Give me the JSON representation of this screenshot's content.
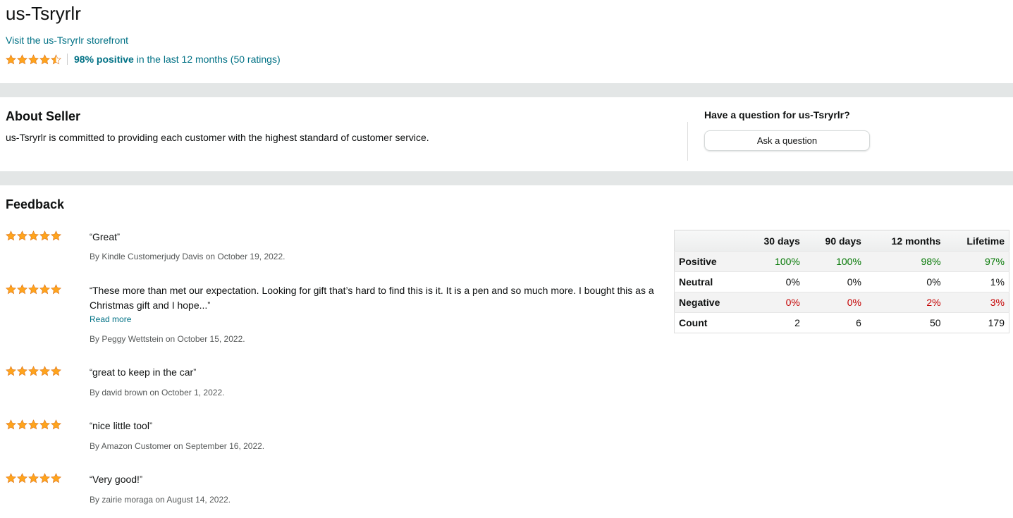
{
  "seller": {
    "name": "us-Tsryrlr",
    "storefront_link": "Visit the us-Tsryrlr storefront",
    "rating_stars": 4.5,
    "positive_percent": "98% positive",
    "rating_period_text": "in the last 12 months (50 ratings)"
  },
  "about": {
    "heading": "About Seller",
    "text": "us-Tsryrlr is committed to providing each customer with the highest standard of customer service."
  },
  "question": {
    "label": "Have a question for us-Tsryrlr?",
    "button": "Ask a question"
  },
  "feedback": {
    "heading": "Feedback",
    "read_more": "Read more",
    "items": [
      {
        "stars": 5,
        "quote": "Great",
        "byline": "By Kindle Customerjudy Davis on October 19, 2022."
      },
      {
        "stars": 5,
        "quote": "These more than met our expectation. Looking for gift that’s hard to find this is it. It is a pen and so much more. I bought this as a Christmas gift and I hope...",
        "byline": "By Peggy Wettstein on October 15, 2022."
      },
      {
        "stars": 5,
        "quote": "great to keep in the car",
        "byline": "By david brown on October 1, 2022."
      },
      {
        "stars": 5,
        "quote": "nice little tool",
        "byline": "By Amazon Customer on September 16, 2022."
      },
      {
        "stars": 5,
        "quote": "Very good!",
        "byline": "By zairie moraga on August 14, 2022."
      }
    ]
  },
  "stats": {
    "columns": [
      "30 days",
      "90 days",
      "12 months",
      "Lifetime"
    ],
    "rows": [
      {
        "label": "Positive",
        "values": [
          "100%",
          "100%",
          "98%",
          "97%"
        ]
      },
      {
        "label": "Neutral",
        "values": [
          "0%",
          "0%",
          "0%",
          "1%"
        ]
      },
      {
        "label": "Negative",
        "values": [
          "0%",
          "0%",
          "2%",
          "3%"
        ]
      },
      {
        "label": "Count",
        "values": [
          "2",
          "6",
          "50",
          "179"
        ]
      }
    ]
  },
  "colors": {
    "link": "#007185",
    "star": "#ffa41c",
    "positive": "#007600",
    "negative": "#c40000",
    "band": "#e3e6e6"
  }
}
